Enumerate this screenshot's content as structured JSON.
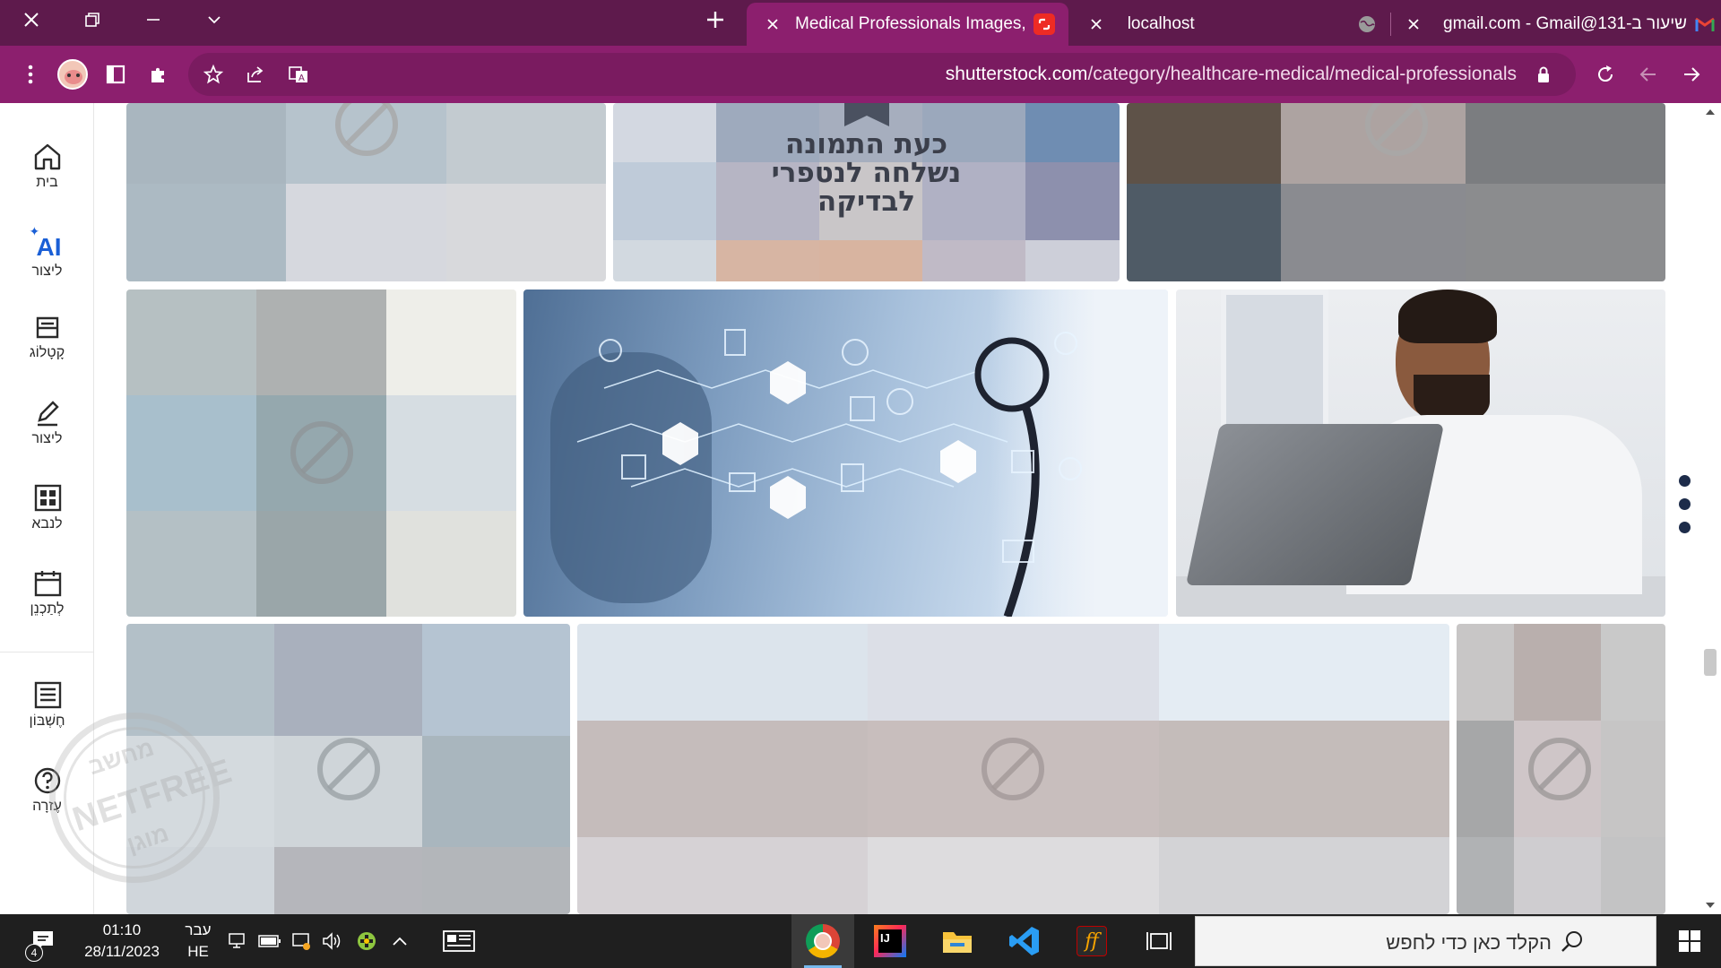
{
  "browser": {
    "tabs": [
      {
        "title": "Medical Professionals Images, Pi",
        "active": true
      },
      {
        "title": "localhost",
        "active": false
      },
      {
        "title": "שיעור ב-131@gmail.com - Gmail",
        "active": false
      }
    ],
    "url_host": "shutterstock.com",
    "url_path": "/category/healthcare-medical/medical-professionals",
    "theme_color": "#8c1f6e"
  },
  "sidebar": {
    "items": [
      {
        "label": "בית",
        "icon": "home-icon"
      },
      {
        "label": "ליצור",
        "icon": "ai-icon",
        "badge": "AI"
      },
      {
        "label": "קָטָלוֹג",
        "icon": "catalog-icon"
      },
      {
        "label": "ליצור",
        "icon": "edit-icon"
      },
      {
        "label": "לנבא",
        "icon": "grid-icon"
      },
      {
        "label": "לְתַכְנֵן",
        "icon": "calendar-icon"
      },
      {
        "label": "חֶשְׁבּוֹן",
        "icon": "list-icon"
      },
      {
        "label": "עֶזרָה",
        "icon": "help-icon"
      }
    ]
  },
  "gallery": {
    "notice_text": [
      "כעת התמונה",
      "נשלחה לנטפרי",
      "לבדיקה"
    ]
  },
  "watermark": {
    "top": "מחשב",
    "middle": "NETFREE",
    "bottom": "מוגן"
  },
  "taskbar": {
    "time": "01:10",
    "date": "28/11/2023",
    "lang_top": "עבר",
    "lang_bottom": "HE",
    "notification_count": "4",
    "search_placeholder": "הקלד כאן כדי לחפש"
  }
}
